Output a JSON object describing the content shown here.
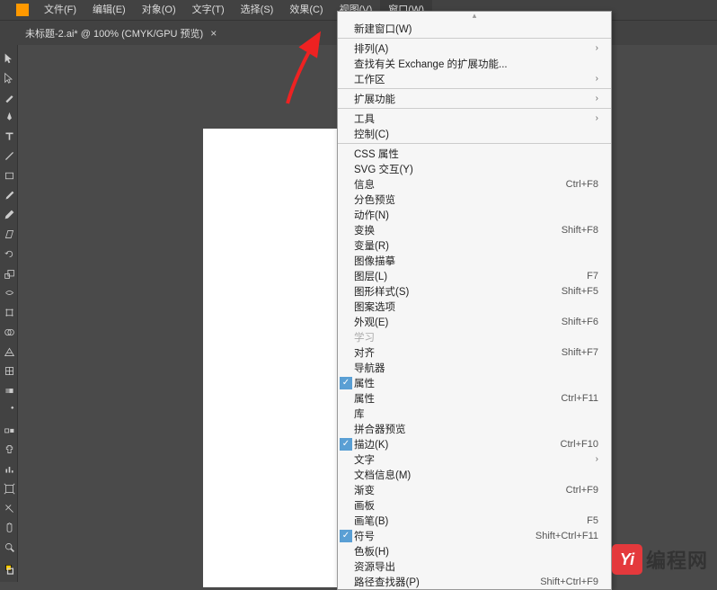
{
  "menu": [
    "文件(F)",
    "编辑(E)",
    "对象(O)",
    "文字(T)",
    "选择(S)",
    "效果(C)",
    "视图(V)",
    "窗口(W)"
  ],
  "active_menu_index": 7,
  "tab": {
    "title": "未标题-2.ai* @ 100% (CMYK/GPU 预览)",
    "close": "×"
  },
  "dropdown": {
    "scroll_top": "▴",
    "items": [
      {
        "label": "新建窗口(W)",
        "check": false,
        "type": "item"
      },
      {
        "type": "div"
      },
      {
        "label": "排列(A)",
        "check": false,
        "type": "sub"
      },
      {
        "label": "查找有关 Exchange 的扩展功能...",
        "check": false,
        "type": "item"
      },
      {
        "label": "工作区",
        "check": false,
        "type": "sub"
      },
      {
        "type": "div"
      },
      {
        "label": "扩展功能",
        "check": false,
        "type": "sub"
      },
      {
        "type": "div"
      },
      {
        "label": "工具",
        "check": false,
        "type": "sub"
      },
      {
        "label": "控制(C)",
        "check": false,
        "type": "item"
      },
      {
        "type": "div"
      },
      {
        "label": "CSS 属性",
        "check": false,
        "type": "item"
      },
      {
        "label": "SVG 交互(Y)",
        "check": false,
        "type": "item"
      },
      {
        "label": "信息",
        "check": false,
        "shortcut": "Ctrl+F8",
        "type": "item"
      },
      {
        "label": "分色预览",
        "check": false,
        "type": "item"
      },
      {
        "label": "动作(N)",
        "check": false,
        "type": "item"
      },
      {
        "label": "变换",
        "check": false,
        "shortcut": "Shift+F8",
        "type": "item"
      },
      {
        "label": "变量(R)",
        "check": false,
        "type": "item"
      },
      {
        "label": "图像描摹",
        "check": false,
        "type": "item"
      },
      {
        "label": "图层(L)",
        "check": false,
        "shortcut": "F7",
        "type": "item"
      },
      {
        "label": "图形样式(S)",
        "check": false,
        "shortcut": "Shift+F5",
        "type": "item"
      },
      {
        "label": "图案选项",
        "check": false,
        "type": "item"
      },
      {
        "label": "外观(E)",
        "check": false,
        "shortcut": "Shift+F6",
        "type": "item"
      },
      {
        "label": "学习",
        "check": false,
        "type": "item",
        "disabled": true
      },
      {
        "label": "对齐",
        "check": false,
        "shortcut": "Shift+F7",
        "type": "item"
      },
      {
        "label": "导航器",
        "check": false,
        "type": "item"
      },
      {
        "label": "属性",
        "check": true,
        "type": "item"
      },
      {
        "label": "属性",
        "check": false,
        "shortcut": "Ctrl+F11",
        "type": "item"
      },
      {
        "label": "库",
        "check": false,
        "type": "item"
      },
      {
        "label": "拼合器预览",
        "check": false,
        "type": "item"
      },
      {
        "label": "描边(K)",
        "check": true,
        "shortcut": "Ctrl+F10",
        "type": "item"
      },
      {
        "label": "文字",
        "check": false,
        "type": "sub"
      },
      {
        "label": "文档信息(M)",
        "check": false,
        "type": "item"
      },
      {
        "label": "渐变",
        "check": false,
        "shortcut": "Ctrl+F9",
        "type": "item"
      },
      {
        "label": "画板",
        "check": false,
        "type": "item"
      },
      {
        "label": "画笔(B)",
        "check": false,
        "shortcut": "F5",
        "type": "item"
      },
      {
        "label": "符号",
        "check": true,
        "shortcut": "Shift+Ctrl+F11",
        "type": "item"
      },
      {
        "label": "色板(H)",
        "check": false,
        "type": "item"
      },
      {
        "label": "资源导出",
        "check": false,
        "type": "item"
      },
      {
        "label": "路径查找器(P)",
        "check": false,
        "shortcut": "Shift+Ctrl+F9",
        "type": "item"
      }
    ]
  },
  "watermark": "编程网"
}
